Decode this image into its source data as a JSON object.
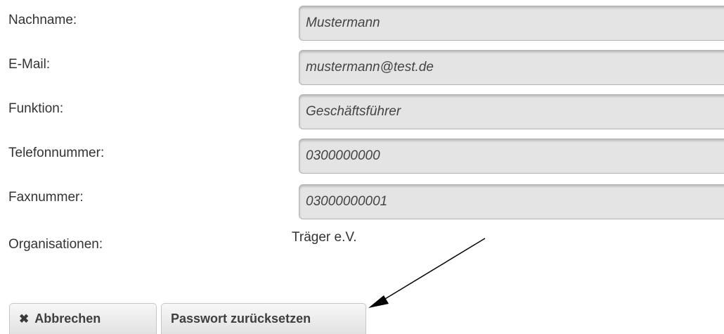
{
  "form": {
    "fields": [
      {
        "label": "Nachname:",
        "value": "Mustermann"
      },
      {
        "label": "E-Mail:",
        "value": "mustermann@test.de"
      },
      {
        "label": "Funktion:",
        "value": "Geschäftsführer"
      },
      {
        "label": "Telefonnummer:",
        "value": "0300000000"
      },
      {
        "label": "Faxnummer:",
        "value": "03000000001"
      }
    ],
    "organizations": {
      "label": "Organisationen:",
      "value": "Träger e.V."
    }
  },
  "buttons": {
    "cancel": {
      "label": "Abbrechen",
      "icon": "close-icon"
    },
    "reset_password": {
      "label": "Passwort zurücksetzen"
    }
  },
  "annotation": {
    "arrow_color": "#000000"
  }
}
